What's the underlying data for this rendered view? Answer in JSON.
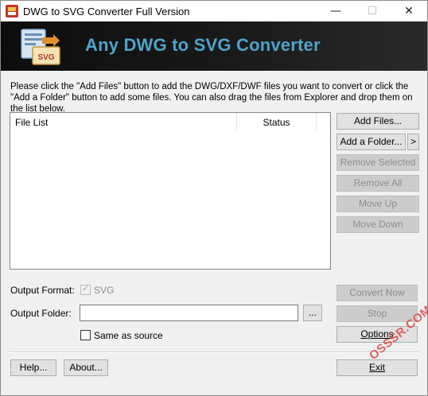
{
  "window": {
    "title": "DWG to SVG Converter Full Version",
    "minimize": "—",
    "maximize": "☐",
    "close": "✕"
  },
  "banner": {
    "title": "Any DWG to SVG Converter",
    "logo_label": "SVG"
  },
  "instructions": "Please click the \"Add Files\" button to add the DWG/DXF/DWF files you want to convert or click the \"Add a Folder\" button to add some files. You can also drag the files from Explorer and drop them on the list below.",
  "file_list": {
    "columns": [
      "File List",
      "Status"
    ],
    "rows": []
  },
  "side_buttons": {
    "add_files": "Add Files...",
    "add_folder": "Add a Folder...",
    "more": ">",
    "remove_selected": "Remove Selected",
    "remove_all": "Remove All",
    "move_up": "Move Up",
    "move_down": "Move Down"
  },
  "output": {
    "format_label": "Output Format:",
    "format_value": "SVG",
    "folder_label": "Output Folder:",
    "folder_value": "",
    "browse": "...",
    "same_as_source": "Same as source"
  },
  "action_buttons": {
    "convert_now": "Convert Now",
    "stop": "Stop",
    "options": "Options"
  },
  "footer": {
    "help": "Help...",
    "about": "About...",
    "exit": "Exit"
  },
  "watermark": "OSSSR.COM",
  "colors": {
    "banner_title": "#4fa3c8",
    "banner_background": "#111111",
    "disabled_text": "#8e8e8e"
  }
}
